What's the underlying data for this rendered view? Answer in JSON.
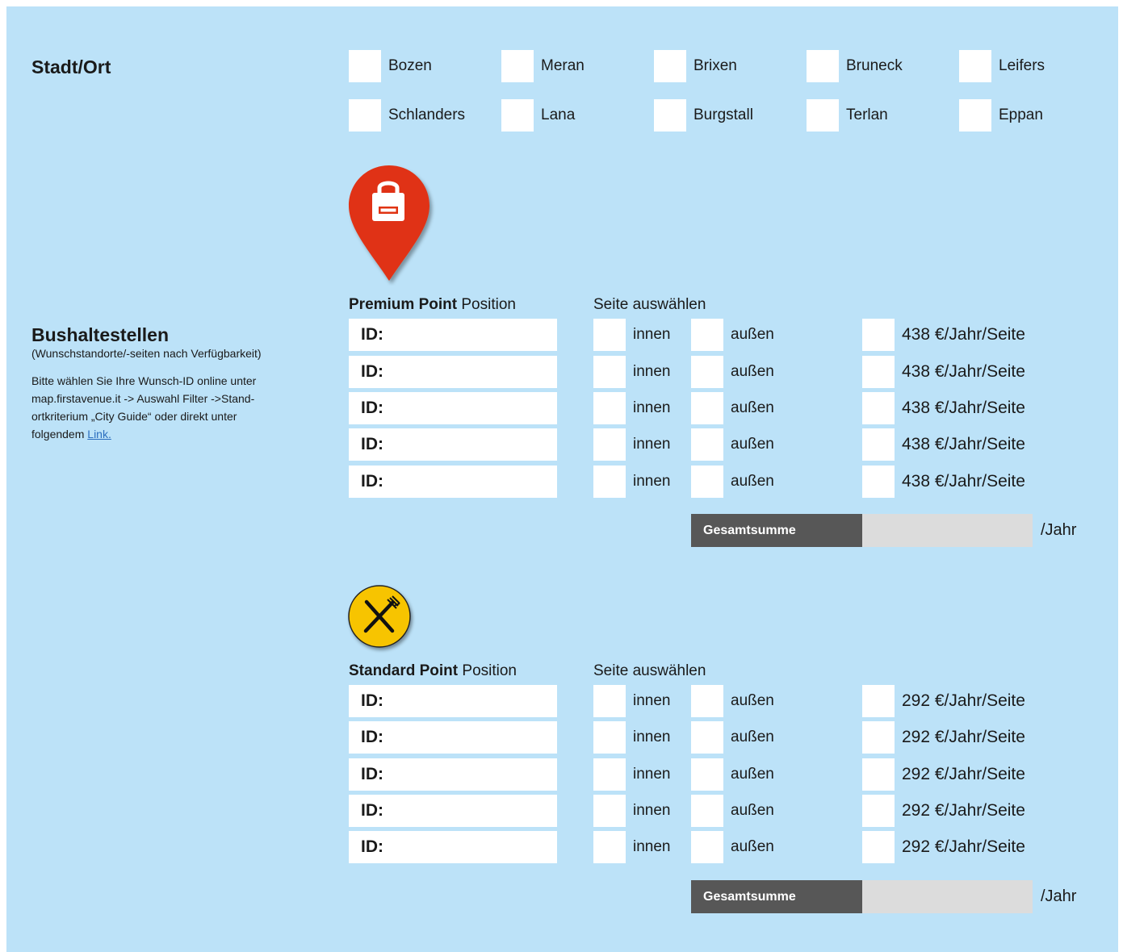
{
  "stadt": {
    "heading": "Stadt/Ort",
    "cities": [
      "Bozen",
      "Meran",
      "Brixen",
      "Bruneck",
      "Leifers",
      "Schlanders",
      "Lana",
      "Burgstall",
      "Terlan",
      "Eppan"
    ]
  },
  "bus": {
    "heading": "Bushaltestellen",
    "subheading": "(Wunschstandorte/-seiten nach Verfügbarkeit)",
    "note_line1": "Bitte wählen Sie Ihre Wunsch-ID online unter",
    "note_line2": "map.firstavenue.it -> Auswahl Filter ->Stand-",
    "note_line3": "ortkriterium „City Guide“ oder direkt unter",
    "note_line4_prefix": "folgendem ",
    "note_link": "Link."
  },
  "premium": {
    "icon": "lock-location-pin-icon",
    "icon_color": "#e03312",
    "title_bold": "Premium Point",
    "title_rest": " Position",
    "side_header": "Seite auswählen",
    "rows": [
      {
        "id_label": "ID:",
        "inner": "innen",
        "outer": "außen",
        "price": "438 €/Jahr/Seite"
      },
      {
        "id_label": "ID:",
        "inner": "innen",
        "outer": "außen",
        "price": "438 €/Jahr/Seite"
      },
      {
        "id_label": "ID:",
        "inner": "innen",
        "outer": "außen",
        "price": "438 €/Jahr/Seite"
      },
      {
        "id_label": "ID:",
        "inner": "innen",
        "outer": "außen",
        "price": "438 €/Jahr/Seite"
      },
      {
        "id_label": "ID:",
        "inner": "innen",
        "outer": "außen",
        "price": "438 €/Jahr/Seite"
      }
    ],
    "total_label": "Gesamtsumme",
    "per_year": "/Jahr"
  },
  "standard": {
    "icon": "fork-knife-icon",
    "icon_color": "#f7c400",
    "title_bold": "Standard Point",
    "title_rest": " Position",
    "side_header": "Seite auswählen",
    "rows": [
      {
        "id_label": "ID:",
        "inner": "innen",
        "outer": "außen",
        "price": "292 €/Jahr/Seite"
      },
      {
        "id_label": "ID:",
        "inner": "innen",
        "outer": "außen",
        "price": "292 €/Jahr/Seite"
      },
      {
        "id_label": "ID:",
        "inner": "innen",
        "outer": "außen",
        "price": "292 €/Jahr/Seite"
      },
      {
        "id_label": "ID:",
        "inner": "innen",
        "outer": "außen",
        "price": "292 €/Jahr/Seite"
      },
      {
        "id_label": "ID:",
        "inner": "innen",
        "outer": "außen",
        "price": "292 €/Jahr/Seite"
      }
    ],
    "total_label": "Gesamtsumme",
    "per_year": "/Jahr"
  }
}
